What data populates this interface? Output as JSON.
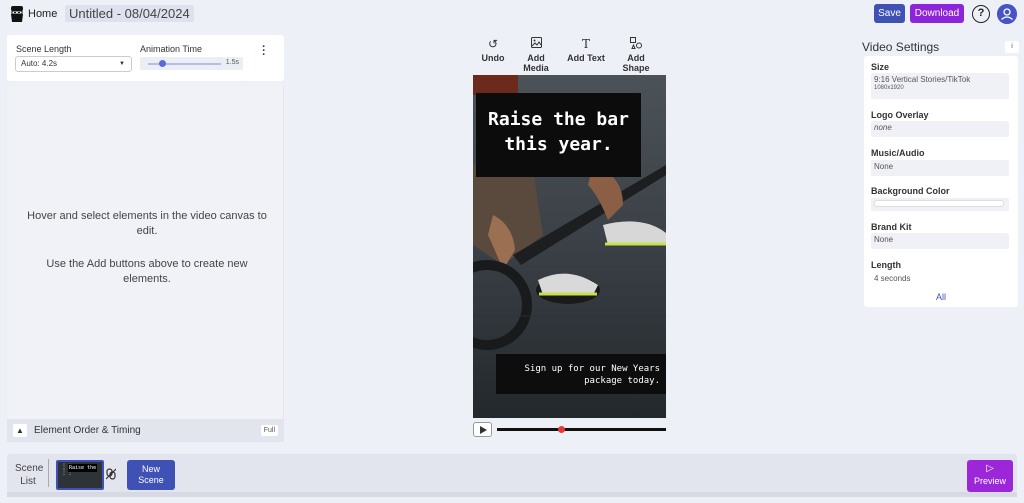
{
  "topbar": {
    "home_label": "Home",
    "project_title": "Untitled - 08/04/2024",
    "save_label": "Save",
    "download_label": "Download",
    "help_glyph": "?"
  },
  "left_settings": {
    "scene_length_label": "Scene Length",
    "scene_length_value": "Auto: 4.2s",
    "animation_time_label": "Animation Time",
    "animation_time_value": "1.5s",
    "animation_time_fraction": 0.15
  },
  "left_panel": {
    "hint_1": "Hover and select elements in the video canvas to edit.",
    "hint_2": "Use the Add buttons above to create new elements.",
    "element_order_label": "Element Order & Timing",
    "full_label": "Full"
  },
  "toolbar": {
    "undo": "Undo",
    "add_media": "Add Media",
    "add_text": "Add Text",
    "add_shape": "Add Shape"
  },
  "canvas": {
    "headline": "Raise the bar this year.",
    "subtext": "Sign up for our New Years package today.",
    "playhead_fraction": 0.36
  },
  "video_settings": {
    "title": "Video Settings",
    "info_glyph": "i",
    "size_label": "Size",
    "size_value": "9:16 Vertical Stories/TikTok",
    "size_dims": "1080x1920",
    "logo_label": "Logo Overlay",
    "logo_value": "none",
    "music_label": "Music/Audio",
    "music_value": "None",
    "bg_label": "Background Color",
    "brand_label": "Brand Kit",
    "brand_value": "None",
    "length_label": "Length",
    "length_value": "4 seconds",
    "all_label": "All"
  },
  "bottom": {
    "scene_list_label": "Scene List",
    "thumb_text": "Raise the",
    "new_scene_label": "New Scene",
    "preview_label": "Preview"
  },
  "colors": {
    "primary": "#3f51b5",
    "download": "#8e24d9",
    "preview": "#9c27d9",
    "playhead": "#e53935"
  }
}
